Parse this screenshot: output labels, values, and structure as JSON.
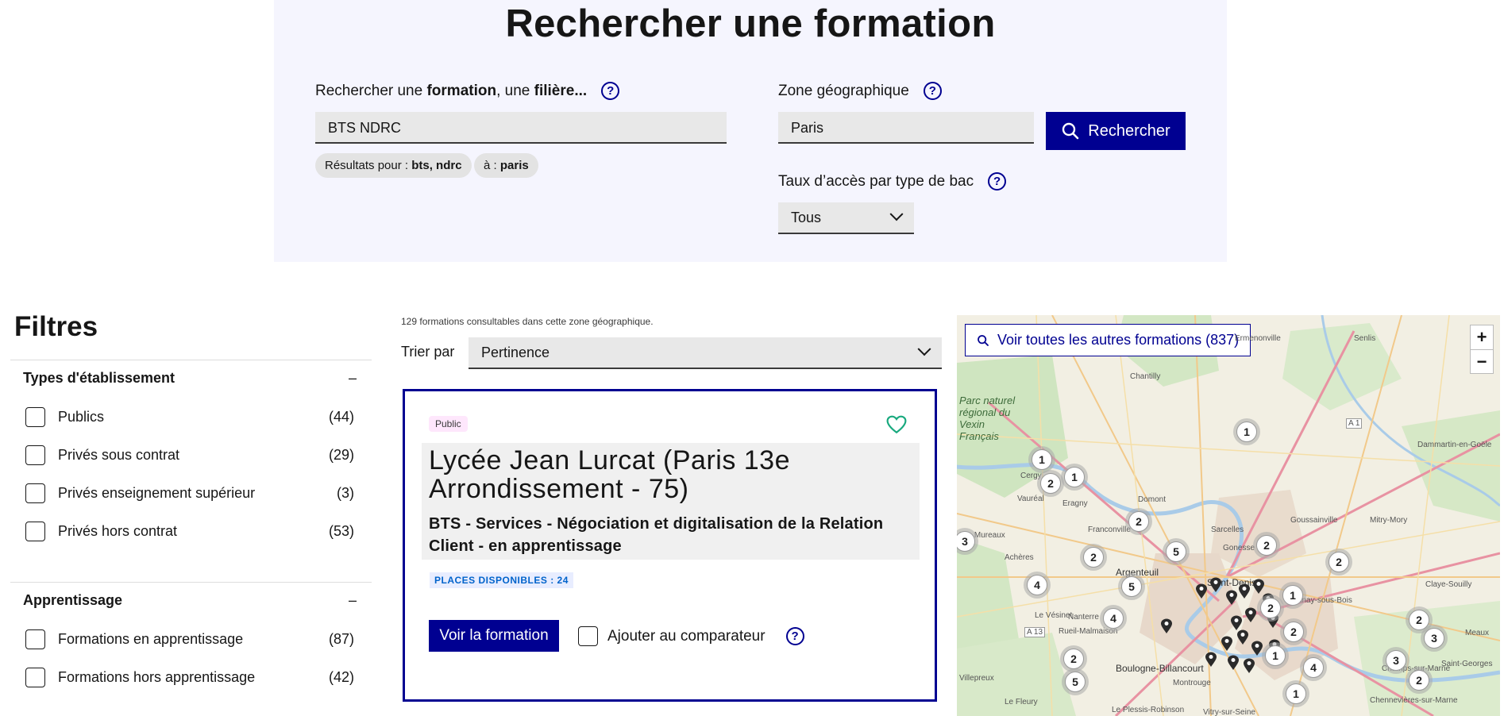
{
  "search": {
    "title": "Rechercher une formation",
    "formation_label_prefix": "Rechercher une ",
    "formation_label_bold1": "formation",
    "formation_label_mid": ", une ",
    "formation_label_bold2": "filière...",
    "formation_value": "BTS NDRC",
    "zone_label": "Zone géographique",
    "zone_value": "Paris",
    "search_button": "Rechercher",
    "tag1_prefix": "Résultats pour : ",
    "tag1_value": "bts, ndrc",
    "tag2_prefix": "à : ",
    "tag2_value": "paris",
    "taux_label": "Taux d’accès par type de bac",
    "taux_value": "Tous",
    "help_glyph": "?"
  },
  "filters": {
    "title": "Filtres",
    "groups": [
      {
        "label": "Types d'établissement",
        "toggle": "–",
        "items": [
          {
            "label": "Publics",
            "count": "(44)"
          },
          {
            "label": "Privés sous contrat",
            "count": "(29)"
          },
          {
            "label": "Privés enseignement supérieur",
            "count": "(3)"
          },
          {
            "label": "Privés hors contrat",
            "count": "(53)"
          }
        ]
      },
      {
        "label": "Apprentissage",
        "toggle": "–",
        "items": [
          {
            "label": "Formations en apprentissage",
            "count": "(87)"
          },
          {
            "label": "Formations hors apprentissage",
            "count": "(42)"
          }
        ]
      }
    ]
  },
  "results": {
    "count_text": "129 formations consultables dans cette zone géographique.",
    "sort_label": "Trier par",
    "sort_value": "Pertinence",
    "card": {
      "badge": "Public",
      "title": "Lycée Jean Lurcat (Paris 13e Arrondissement - 75)",
      "subtitle": "BTS - Services - Négociation et digitalisation de la Relation Client - en apprentissage",
      "places": "PLACES DISPONIBLES : 24",
      "voir_button": "Voir la formation",
      "compare_label": "Ajouter au comparateur"
    }
  },
  "map": {
    "all_button": "Voir toutes les autres formations (837)",
    "zoom_in": "+",
    "zoom_out": "−",
    "clusters": [
      "1",
      "1",
      "2",
      "1",
      "3",
      "2",
      "2",
      "5",
      "2",
      "2",
      "4",
      "5",
      "1",
      "4",
      "2",
      "2",
      "3",
      "3",
      "2",
      "5",
      "4",
      "1",
      "1",
      "2"
    ],
    "places": [
      "Senlis",
      "Chantilly",
      "Parc naturel régional du Vexin Français",
      "Cergy",
      "Vauréal",
      "Eragny",
      "Sarcelles",
      "Gonesse",
      "Argenteuil",
      "Saint-Denis",
      "Nanterre",
      "Rueil-Malmaison",
      "Le Vésinet",
      "Boulogne-Billancourt",
      "Montrouge",
      "Vitry-sur-Seine",
      "Villepreux",
      "Champs-sur-Marne",
      "Chennevières-sur-Marne",
      "Goussainville",
      "Mitry-Mory",
      "Dammartin-en-Goële",
      "Claye-Souilly",
      "Aulnay-sous-Bois",
      "Domont",
      "Franconville",
      "Les Mureaux",
      "Achères",
      "Le Plessis-Robinson",
      "Meaux",
      "Le Fleury",
      "Saint-Georges",
      "Ermenonville",
      "A 1",
      "A 13"
    ]
  },
  "colors": {
    "primary": "#000091",
    "panel_bg": "#f5f5fe",
    "input_bg": "#e8e8e8",
    "public_badge_bg": "#fee7fc",
    "places_badge_bg": "#e8edff",
    "heart": "#18a97e"
  }
}
